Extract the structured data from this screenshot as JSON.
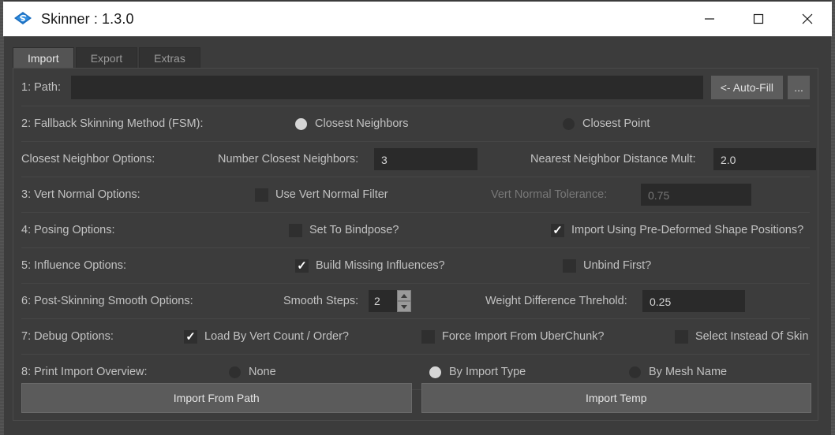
{
  "window": {
    "title": "Skinner : 1.3.0",
    "icon": "skinner-app-icon",
    "minimize": "—",
    "maximize": "□",
    "close": "✕"
  },
  "tabs": [
    {
      "label": "Import",
      "active": true
    },
    {
      "label": "Export",
      "active": false
    },
    {
      "label": "Extras",
      "active": false
    }
  ],
  "rows": {
    "path": {
      "label": "1: Path:",
      "value": "",
      "placeholder": "",
      "autofill_label": "<- Auto-Fill",
      "browse_label": "..."
    },
    "fsm": {
      "label": "2: Fallback Skinning Method (FSM):",
      "option_a": "Closest Neighbors",
      "option_a_selected": true,
      "option_b": "Closest Point",
      "option_b_selected": false
    },
    "closest_neighbor_options": {
      "label": "Closest Neighbor Options:",
      "num_label": "Number Closest Neighbors:",
      "num_value": "3",
      "dist_label": "Nearest Neighbor Distance Mult:",
      "dist_value": "2.0"
    },
    "vert_normal": {
      "label": "3: Vert Normal Options:",
      "filter_label": "Use Vert Normal Filter",
      "filter_checked": false,
      "tolerance_label": "Vert Normal Tolerance:",
      "tolerance_value": "0.75",
      "tolerance_disabled": true
    },
    "posing": {
      "label": "4: Posing Options:",
      "bindpose_label": "Set To Bindpose?",
      "bindpose_checked": false,
      "predeformed_label": "Import Using Pre-Deformed Shape Positions?",
      "predeformed_checked": true
    },
    "influence": {
      "label": "5: Influence Options:",
      "build_label": "Build Missing Influences?",
      "build_checked": true,
      "unbind_label": "Unbind First?",
      "unbind_checked": false
    },
    "smooth": {
      "label": "6: Post-Skinning Smooth Options:",
      "steps_label": "Smooth Steps:",
      "steps_value": "2",
      "threshold_label": "Weight Difference Threhold:",
      "threshold_value": "0.25"
    },
    "debug": {
      "label": "7: Debug Options:",
      "vertcount_label": "Load By Vert Count / Order?",
      "vertcount_checked": true,
      "uberchunk_label": "Force Import From UberChunk?",
      "uberchunk_checked": false,
      "select_label": "Select Instead Of Skin",
      "select_checked": false
    },
    "overview": {
      "label": "8: Print Import Overview:",
      "none_label": "None",
      "none_selected": false,
      "bytype_label": "By Import Type",
      "bytype_selected": true,
      "byname_label": "By Mesh Name",
      "byname_selected": false
    }
  },
  "actions": {
    "import_from_path": "Import From Path",
    "import_temp": "Import Temp"
  },
  "colors": {
    "panel_bg": "#3c3c3c",
    "field_bg": "#2a2a2a",
    "button_bg": "#5b5b5b",
    "text": "#c2c2c2",
    "titlebar_bg": "#ffffff",
    "accent_icon": "#1d6fc0"
  }
}
